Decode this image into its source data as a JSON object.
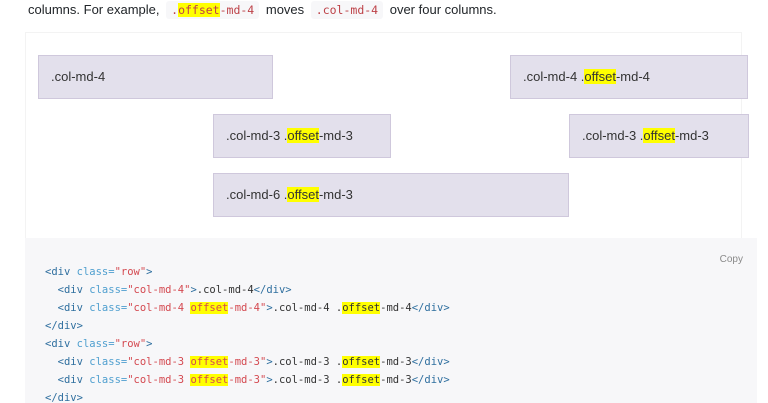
{
  "intro": {
    "prefix": "columns. For example,",
    "code1_hl": "offset",
    "code1_rest": "-md-4",
    "middle": "moves",
    "code2": ".col-md-4",
    "suffix": "over four columns."
  },
  "example": {
    "rows": [
      {
        "cols": [
          {
            "label": ".col-md-4"
          },
          {
            "label_a": ".col-md-4 .",
            "label_hl": "offset",
            "label_b": "-md-4"
          }
        ]
      },
      {
        "cols": [
          {
            "label_a": ".col-md-3 .",
            "label_hl": "offset",
            "label_b": "-md-3"
          },
          {
            "label_a": ".col-md-3 .",
            "label_hl": "offset",
            "label_b": "-md-3"
          }
        ]
      },
      {
        "cols": [
          {
            "label_a": ".col-md-6 .",
            "label_hl": "offset",
            "label_b": "-md-3"
          }
        ]
      }
    ]
  },
  "code": {
    "copy_label": "Copy",
    "lines": [
      "<div class=\"row\">",
      "  <div class=\"col-md-4\">.col-md-4</div>",
      "  <div class=\"col-md-4 offset-md-4\">.col-md-4 .offset-md-4</div>",
      "</div>",
      "<div class=\"row\">",
      "  <div class=\"col-md-3 offset-md-3\">.col-md-3 .offset-md-3</div>",
      "  <div class=\"col-md-3 offset-md-3\">.col-md-3 .offset-md-3</div>",
      "</div>"
    ]
  },
  "colors": {
    "highlight": "#ffff00",
    "col_bg": "#e3e0ec",
    "col_border": "#cfc8dc",
    "code_bg": "#f7f7f9",
    "code_tag": "#2f6f9f",
    "code_attr": "#4f9fcf",
    "code_string": "#d44950"
  }
}
